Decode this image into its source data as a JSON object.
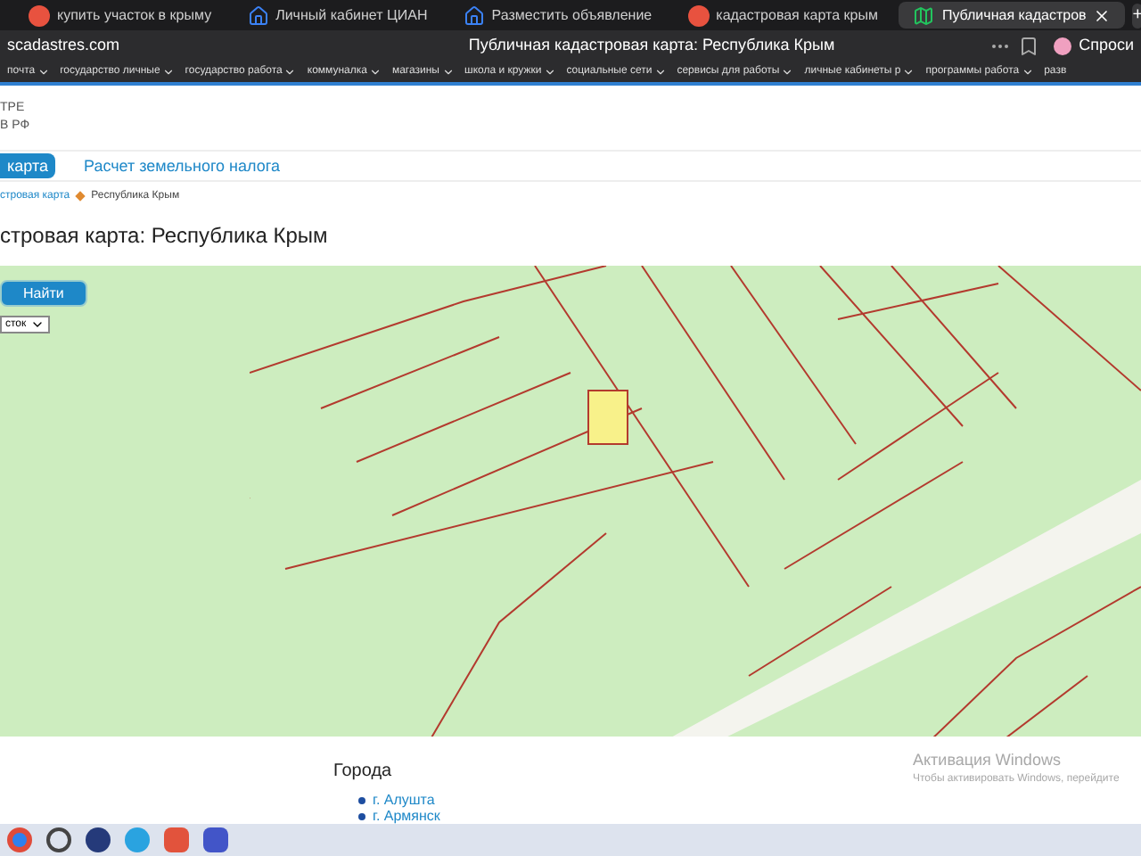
{
  "browser": {
    "tabs": [
      {
        "title": "купить участок в крыму",
        "selected": false,
        "kind": "search"
      },
      {
        "title": "Личный кабинет ЦИАН",
        "selected": false,
        "kind": "site"
      },
      {
        "title": "Разместить объявление",
        "selected": false,
        "kind": "site"
      },
      {
        "title": "кадастровая карта крым",
        "selected": false,
        "kind": "search"
      },
      {
        "title": "Публичная кадастров",
        "selected": true,
        "kind": "map"
      }
    ],
    "new_tab_label": "+",
    "address": "scadastres.com",
    "page_title": "Публичная кадастровая карта: Республика Крым",
    "ask_button": "Спроси",
    "bookmarks": [
      "почта",
      "государство личные",
      "государство работа",
      "коммуналка",
      "магазины",
      "школа и кружки",
      "социальные сети",
      "сервисы для работы",
      "личные кабинеты р",
      "программы работа",
      "разв"
    ]
  },
  "site": {
    "logo_lines": [
      "ТРЕ",
      "В РФ"
    ],
    "nav": [
      {
        "label": "карта",
        "selected": true
      },
      {
        "label": "Расчет земельного налога",
        "selected": false
      }
    ],
    "breadcrumbs": [
      "стровая карта",
      "Республика Крым"
    ],
    "heading": "стровая карта: Республика Крым",
    "map": {
      "search_button": "Найти",
      "type_select": "сток"
    },
    "cities": {
      "title": "Города",
      "items": [
        "г. Алушта",
        "г. Армянск"
      ]
    }
  },
  "activation": {
    "title": "Активация Windows",
    "text": "Чтобы активировать Windows, перейдите"
  }
}
